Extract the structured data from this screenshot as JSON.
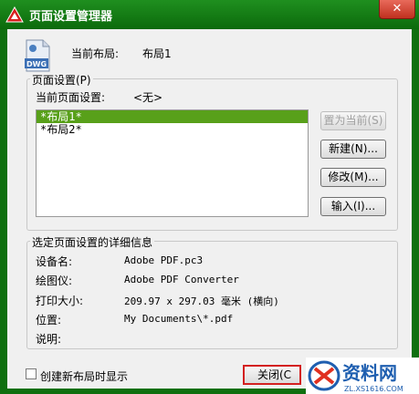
{
  "window": {
    "title": "页面设置管理器",
    "close_glyph": "✕"
  },
  "current_layout": {
    "label": "当前布局:",
    "value": "布局1"
  },
  "page_setups": {
    "group_title": "页面设置(P)",
    "current_label": "当前页面设置:",
    "current_value": "<无>",
    "items": [
      "*布局1*",
      "*布局2*"
    ]
  },
  "buttons": {
    "set_current": "置为当前(S)",
    "new": "新建(N)...",
    "modify": "修改(M)...",
    "import": "输入(I)..."
  },
  "details": {
    "group_title": "选定页面设置的详细信息",
    "rows": [
      {
        "label": "设备名:",
        "value": "Adobe PDF.pc3"
      },
      {
        "label": "绘图仪:",
        "value": "Adobe PDF Converter"
      },
      {
        "label": "打印大小:",
        "value": "209.97 x 297.03 毫米 (横向)"
      },
      {
        "label": "位置:",
        "value": "My Documents\\*.pdf"
      },
      {
        "label": "说明:",
        "value": ""
      }
    ]
  },
  "checkbox": {
    "label": "创建新布局时显示",
    "checked": false
  },
  "close_button": {
    "label": "关闭(C"
  },
  "icons": {
    "app": "autocad-icon",
    "file": "dwg-file-icon"
  },
  "watermark": {
    "text": "资料网",
    "sub": "ZL.XS1616.COM"
  }
}
